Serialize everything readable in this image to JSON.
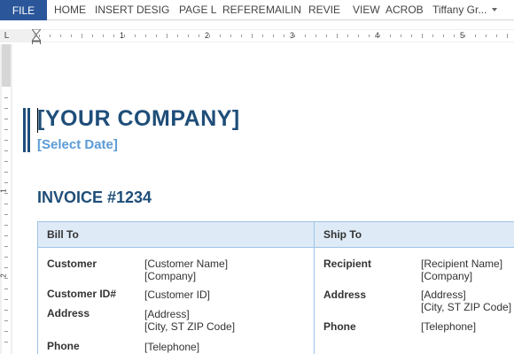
{
  "ribbon": {
    "file_label": "FILE",
    "tabs": [
      "HOME",
      "INSERT",
      "DESIG",
      "PAGE L",
      "REFERE",
      "MAILIN",
      "REVIE",
      "VIEW",
      "ACROB"
    ],
    "user": "Tiffany Gr..."
  },
  "ruler": {
    "corner": "L",
    "numbers": [
      "1",
      "2",
      "3",
      "4",
      "5"
    ],
    "vertical_numbers": [
      "1",
      "2"
    ]
  },
  "document": {
    "company": "[YOUR COMPANY]",
    "date": "[Select Date]",
    "invoice": "INVOICE #1234",
    "bill_to": {
      "header": "Bill To",
      "customer_label": "Customer",
      "customer_name": "[Customer Name]",
      "company": "[Company]",
      "customer_id_label": "Customer ID#",
      "customer_id": "[Customer ID]",
      "address_label": "Address",
      "address": "[Address]",
      "city": "[City, ST  ZIP Code]",
      "phone_label": "Phone",
      "phone": "[Telephone]"
    },
    "ship_to": {
      "header": "Ship To",
      "recipient_label": "Recipient",
      "recipient_name": "[Recipient Name]",
      "company": "[Company]",
      "address_label": "Address",
      "address": "[Address]",
      "city": "[City, ST  ZIP Code]",
      "phone_label": "Phone",
      "phone": "[Telephone]"
    }
  },
  "colors": {
    "file_tab": "#2b579a",
    "heading": "#1f4e79",
    "date": "#5b9bd5",
    "table_header": "#deebf7",
    "table_border": "#9dc3e6"
  }
}
